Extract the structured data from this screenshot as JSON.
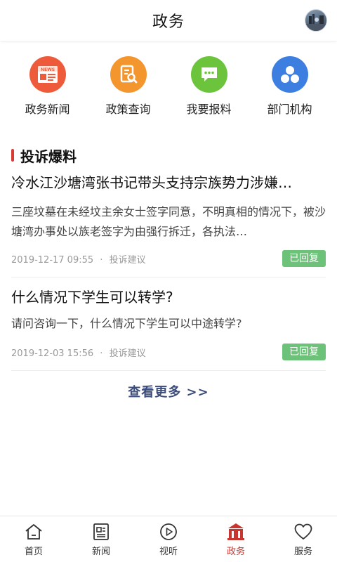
{
  "header": {
    "title": "政务"
  },
  "quick_links": [
    {
      "label": "政务新闻",
      "icon": "news-icon",
      "color": "#ee5b3a"
    },
    {
      "label": "政策查询",
      "icon": "policy-search-icon",
      "color": "#f4962e"
    },
    {
      "label": "我要报料",
      "icon": "chat-bubble-icon",
      "color": "#6cc43d"
    },
    {
      "label": "部门机构",
      "icon": "department-icon",
      "color": "#3d7fe0"
    }
  ],
  "section": {
    "title": "投诉爆料",
    "accent": "#d83a34"
  },
  "complaints": [
    {
      "title": "冷水江沙塘湾张书记带头支持宗族势力涉嫌…",
      "summary": "三座坟墓在未经坟主余女士签字同意，不明真相的情况下，被沙塘湾办事处以族老签字为由强行拆迁，各执法…",
      "date": "2019-12-17 09:55",
      "separator": "·",
      "category": "投诉建议",
      "status": "已回复"
    },
    {
      "title": "什么情况下学生可以转学?",
      "summary": "请问咨询一下，什么情况下学生可以中途转学?",
      "date": "2019-12-03 15:56",
      "separator": "·",
      "category": "投诉建议",
      "status": "已回复"
    }
  ],
  "more": {
    "label": "查看更多 >>"
  },
  "tabbar": {
    "items": [
      {
        "label": "首页",
        "icon": "home-icon"
      },
      {
        "label": "新闻",
        "icon": "newspaper-icon"
      },
      {
        "label": "视听",
        "icon": "play-icon"
      },
      {
        "label": "政务",
        "icon": "government-building-icon",
        "active": true
      },
      {
        "label": "服务",
        "icon": "heart-icon"
      }
    ],
    "active_color": "#c9362f"
  }
}
